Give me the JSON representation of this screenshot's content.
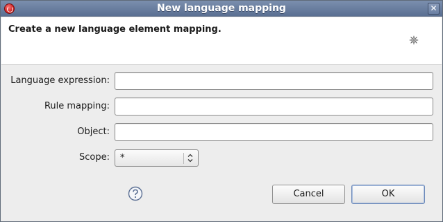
{
  "window": {
    "title": "New language mapping",
    "close_glyph": "✕",
    "app_icon": "eclipse-app-icon"
  },
  "banner": {
    "message": "Create a new language element mapping.",
    "icon": "gear-icon"
  },
  "form": {
    "language_expression": {
      "label": "Language expression:",
      "value": ""
    },
    "rule_mapping": {
      "label": "Rule mapping:",
      "value": ""
    },
    "object": {
      "label": "Object:",
      "value": ""
    },
    "scope": {
      "label": "Scope:",
      "selected": "*"
    }
  },
  "footer": {
    "help_icon": "help-icon",
    "cancel_label": "Cancel",
    "ok_label": "OK"
  },
  "colors": {
    "titlebar": "#5a6f92",
    "dialog_bg": "#ededed",
    "banner_bg": "#ffffff"
  }
}
